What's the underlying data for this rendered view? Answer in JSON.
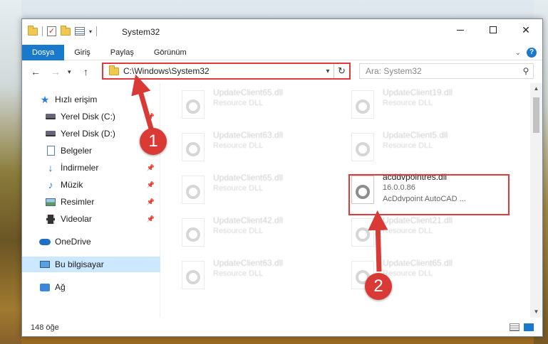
{
  "window": {
    "title": "System32"
  },
  "ribbon": {
    "tabs": [
      "Dosya",
      "Giriş",
      "Paylaş",
      "Görünüm"
    ],
    "help_label": "?"
  },
  "address": {
    "path": "C:\\Windows\\System32",
    "search_placeholder": "Ara: System32"
  },
  "sidebar": {
    "items": [
      {
        "label": "Hızlı erişim",
        "icon": "star-icon"
      },
      {
        "label": "Yerel Disk (C:)",
        "icon": "drive-icon",
        "pinned": true
      },
      {
        "label": "Yerel Disk (D:)",
        "icon": "drive-icon"
      },
      {
        "label": "Belgeler",
        "icon": "documents-icon"
      },
      {
        "label": "İndirmeler",
        "icon": "downloads-icon",
        "pinned": true
      },
      {
        "label": "Müzik",
        "icon": "music-icon",
        "pinned": true
      },
      {
        "label": "Resimler",
        "icon": "pictures-icon",
        "pinned": true
      },
      {
        "label": "Videolar",
        "icon": "videos-icon",
        "pinned": true
      },
      {
        "label": "OneDrive",
        "icon": "onedrive-icon"
      },
      {
        "label": "Bu bilgisayar",
        "icon": "computer-icon",
        "selected": true
      },
      {
        "label": "Ağ",
        "icon": "network-icon"
      }
    ]
  },
  "files": [
    {
      "name": "UpdateClient65.dll",
      "desc": "Resource DLL"
    },
    {
      "name": "UpdateClient19.dll",
      "desc": "Resource DLL"
    },
    {
      "name": "UpdateClient63.dll",
      "desc": "Resource DLL"
    },
    {
      "name": "UpdateClient5.dll",
      "desc": "Resource DLL"
    },
    {
      "name": "UpdateClient65.dll",
      "desc": "Resource DLL"
    },
    {
      "name": "acddvpointres.dll",
      "version": "16.0.0.86",
      "desc": "AcDdvpoint AutoCAD ...",
      "focused": true
    },
    {
      "name": "UpdateClient42.dll",
      "desc": "Resource DLL"
    },
    {
      "name": "UpdateClient21.dll",
      "desc": "Resource DLL"
    },
    {
      "name": "UpdateClient63.dll",
      "desc": "Resource DLL"
    },
    {
      "name": "UpdateClient65.dll",
      "desc": "Resource DLL"
    }
  ],
  "status": {
    "item_count": "148 öğe"
  },
  "annotations": {
    "badge1": "1",
    "badge2": "2",
    "color": "#e0393e"
  }
}
